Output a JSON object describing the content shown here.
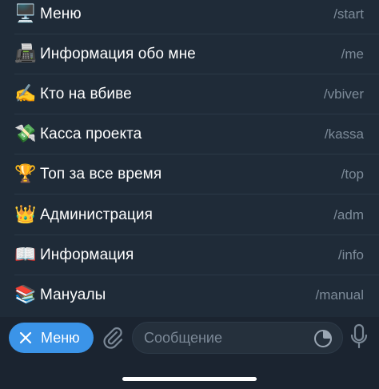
{
  "commands": [
    {
      "icon": "desktop-computer-icon",
      "emoji": "🖥️",
      "label": "Меню",
      "command": "/start"
    },
    {
      "icon": "fax-machine-icon",
      "emoji": "📠",
      "label": "Информация обо мне",
      "command": "/me"
    },
    {
      "icon": "writing-hand-icon",
      "emoji": "✍️",
      "label": "Кто на вбиве",
      "command": "/vbiver"
    },
    {
      "icon": "money-with-wings-icon",
      "emoji": "💸",
      "label": "Касса проекта",
      "command": "/kassa"
    },
    {
      "icon": "trophy-icon",
      "emoji": "🏆",
      "label": "Топ за все время",
      "command": "/top"
    },
    {
      "icon": "crown-icon",
      "emoji": "👑",
      "label": "Администрация",
      "command": "/adm"
    },
    {
      "icon": "open-book-icon",
      "emoji": "📖",
      "label": "Информация",
      "command": "/info"
    },
    {
      "icon": "books-icon",
      "emoji": "📚",
      "label": "Мануалы",
      "command": "/manual"
    }
  ],
  "composer": {
    "menu_button_label": "Меню",
    "message_placeholder": "Сообщение"
  },
  "colors": {
    "accent": "#3b94e8",
    "background": "#1f2b38",
    "secondary_text": "#7d8b99"
  }
}
